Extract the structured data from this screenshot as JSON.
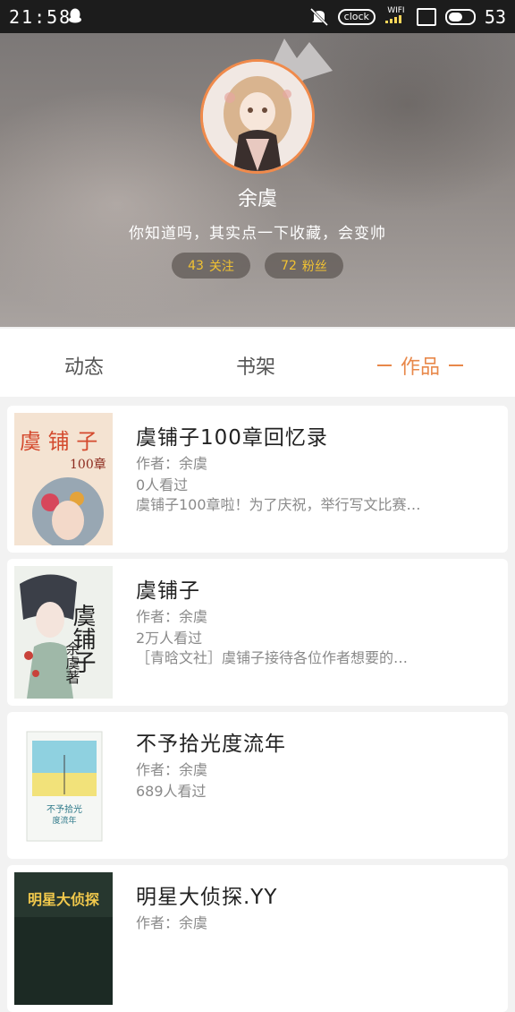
{
  "status_bar": {
    "time": "21:58",
    "clock_label": "clock",
    "wifi_label": "WIFI",
    "battery_level": "53"
  },
  "profile": {
    "username": "余虞",
    "bio": "你知道吗，其实点一下收藏，会变帅",
    "follow_count": "43",
    "follow_label": "关注",
    "fans_count": "72",
    "fans_label": "粉丝",
    "avatar_border_color": "#f08a4b"
  },
  "tabs": [
    {
      "label": "动态",
      "active": false
    },
    {
      "label": "书架",
      "active": false
    },
    {
      "label": "作品",
      "active": true
    }
  ],
  "accent_color": "#e8884a",
  "books": [
    {
      "title": "虞铺子100章回忆录",
      "author": "作者：余虞",
      "views": "0人看过",
      "description": "虞铺子100章啦！为了庆祝，举行写文比赛…",
      "cover_text": "虞 铺 子",
      "cover_subtext": "100章"
    },
    {
      "title": "虞铺子",
      "author": "作者：余虞",
      "views": "2万人看过",
      "description": "［青晗文社］虞铺子接待各位作者想要的…",
      "cover_text": "虞铺子",
      "cover_subtext": "余虞著"
    },
    {
      "title": "不予拾光度流年",
      "author": "作者：余虞",
      "views": "689人看过",
      "description": "",
      "cover_text": "不予拾光",
      "cover_subtext": "度流年"
    },
    {
      "title": "明星大侦探.YY",
      "author": "作者：余虞",
      "views": "",
      "description": "",
      "cover_text": "明星大侦探",
      "cover_subtext": ""
    }
  ]
}
